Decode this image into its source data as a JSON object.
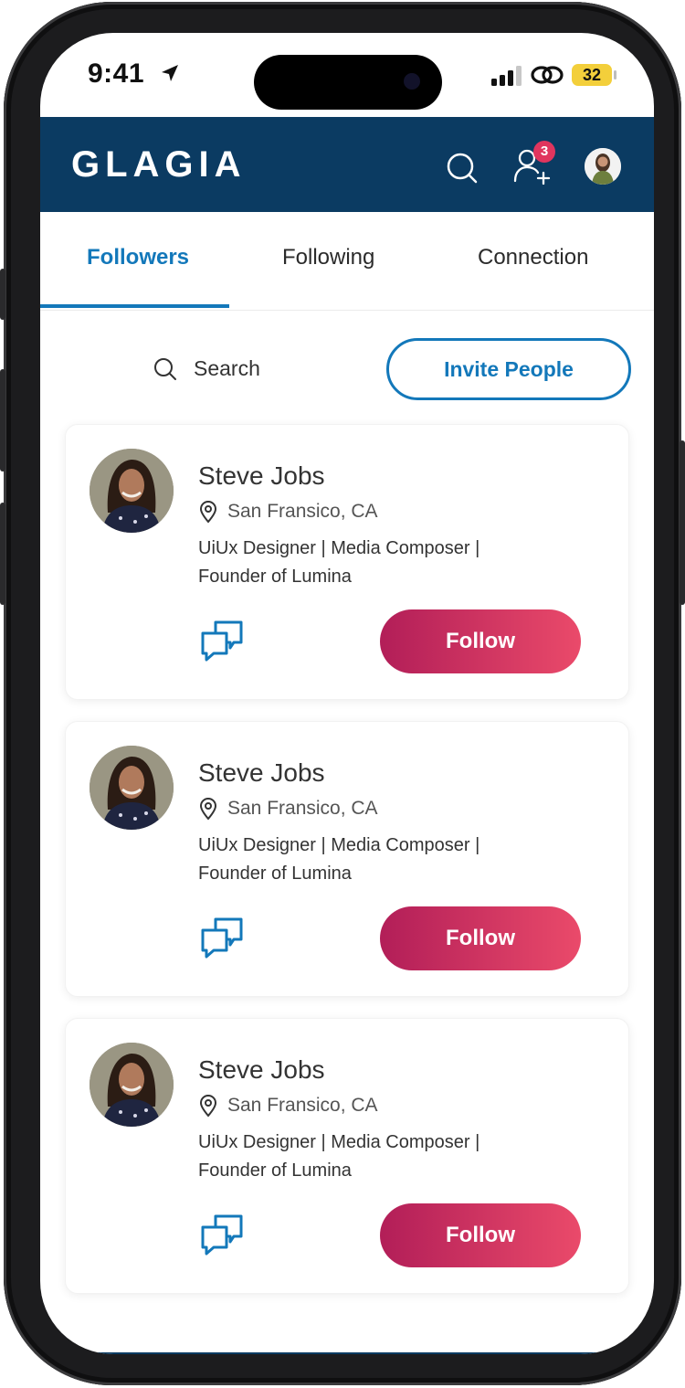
{
  "status_bar": {
    "time": "9:41",
    "battery": "32"
  },
  "header": {
    "brand": "GLAGIA",
    "notification_count": "3"
  },
  "tabs": [
    {
      "label": "Followers",
      "active": true
    },
    {
      "label": "Following",
      "active": false
    },
    {
      "label": "Connection",
      "active": false
    }
  ],
  "search": {
    "placeholder": "Search"
  },
  "invite_button": {
    "label": "Invite People"
  },
  "cards": [
    {
      "name": "Steve Jobs",
      "location": "San Fransico, CA",
      "bio_line1": "UiUx Designer |  Media Composer |",
      "bio_line2": "Founder of Lumina",
      "follow_label": "Follow"
    },
    {
      "name": "Steve Jobs",
      "location": "San Fransico, CA",
      "bio_line1": "UiUx Designer |  Media Composer |",
      "bio_line2": "Founder of Lumina",
      "follow_label": "Follow"
    },
    {
      "name": "Steve Jobs",
      "location": "San Fransico, CA",
      "bio_line1": "UiUx Designer |  Media Composer |",
      "bio_line2": "Founder of Lumina",
      "follow_label": "Follow"
    }
  ],
  "colors": {
    "header_bg": "#0b3b62",
    "accent_blue": "#1378ba",
    "follow_gradient_start": "#b21e58",
    "follow_gradient_end": "#ea4a6a",
    "badge": "#e0355e"
  },
  "icons": [
    "location-arrow-icon",
    "signal-icon",
    "link-icon",
    "search-icon",
    "add-user-icon",
    "pin-icon",
    "chat-icon"
  ]
}
